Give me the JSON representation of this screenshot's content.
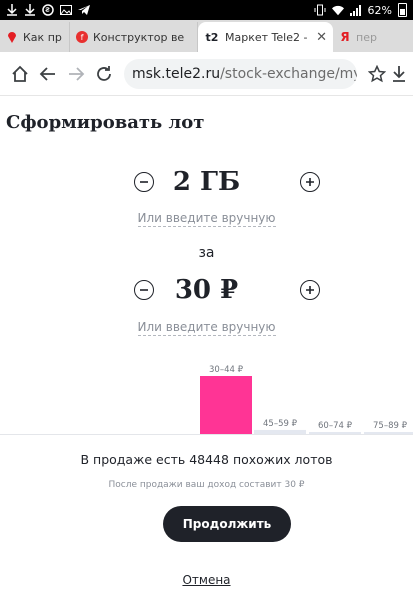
{
  "status_bar": {
    "battery": "62%",
    "icons": [
      "download-icon",
      "download-icon",
      "skype-icon",
      "image-icon",
      "telegram-icon",
      "vibrate-icon",
      "wifi-icon",
      "signal-icon",
      "battery-icon"
    ]
  },
  "tabs": [
    {
      "label": "Как пр",
      "favicon": "yandex-pin-icon",
      "active": false
    },
    {
      "label": "Конструктор ве",
      "favicon": "tele2-red-icon",
      "active": false
    },
    {
      "label": "Маркет Tele2 -",
      "favicon": "tele2-logo-icon",
      "active": true
    },
    {
      "label": "пер",
      "favicon": "yandex-icon",
      "active": false
    }
  ],
  "tab_logo_text": "t2",
  "address_bar": {
    "host": "msk.tele2.ru",
    "path": "/stock-exchange/my"
  },
  "page": {
    "title": "Сформировать лот",
    "volume": {
      "value": "2 ГБ",
      "manual_link": "Или введите вручную"
    },
    "for_label": "за",
    "price": {
      "value": "30 ₽",
      "manual_link": "Или введите вручную"
    },
    "similar_lots": "В продаже есть 48448 похожих лотов",
    "income_note": "После продажи ваш доход составит 30 ₽",
    "continue_label": "Продолжить",
    "cancel_label": "Отмена"
  },
  "chart_data": {
    "type": "bar",
    "categories": [
      "30–44 ₽",
      "45–59 ₽",
      "60–74 ₽",
      "75–89 ₽"
    ],
    "values": [
      100,
      7,
      3,
      2
    ],
    "highlight_index": 0,
    "colors": {
      "highlight": "#ff3495",
      "rest": "#e4e8f0"
    }
  },
  "colors": {
    "text": "#1f2229",
    "muted": "#8a8f98",
    "button": "#1f2229",
    "highlight_bar": "#ff3495"
  }
}
